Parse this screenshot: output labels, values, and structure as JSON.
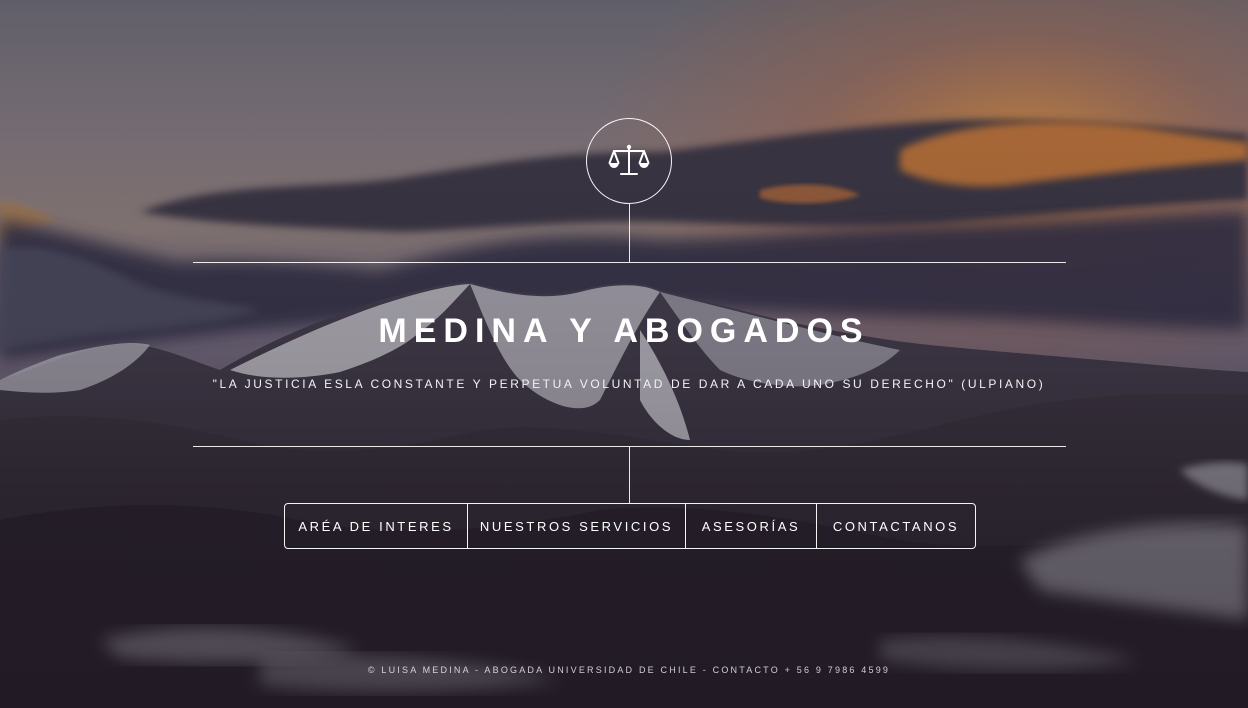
{
  "header": {
    "logo_icon": "scales-of-justice-icon"
  },
  "main": {
    "title": "MEDINA Y ABOGADOS",
    "quote": "\"LA JUSTICIA ESLA CONSTANTE Y PERPETUA VOLUNTAD DE DAR A CADA UNO SU DERECHO\" (ULPIANO)"
  },
  "nav": {
    "items": [
      {
        "label": "ARÉA DE INTERES"
      },
      {
        "label": "NUESTROS SERVICIOS"
      },
      {
        "label": "ASESORÍAS"
      },
      {
        "label": "CONTACTANOS"
      }
    ]
  },
  "footer": {
    "text": "© LUISA MEDINA - ABOGADA UNIVERSIDAD DE CHILE - CONTACTO + 56 9 7986 4599"
  },
  "colors": {
    "text": "#ffffff",
    "sky_top": "#6f6e78",
    "sunset": "#e8943a",
    "mountain": "#3b3440"
  }
}
